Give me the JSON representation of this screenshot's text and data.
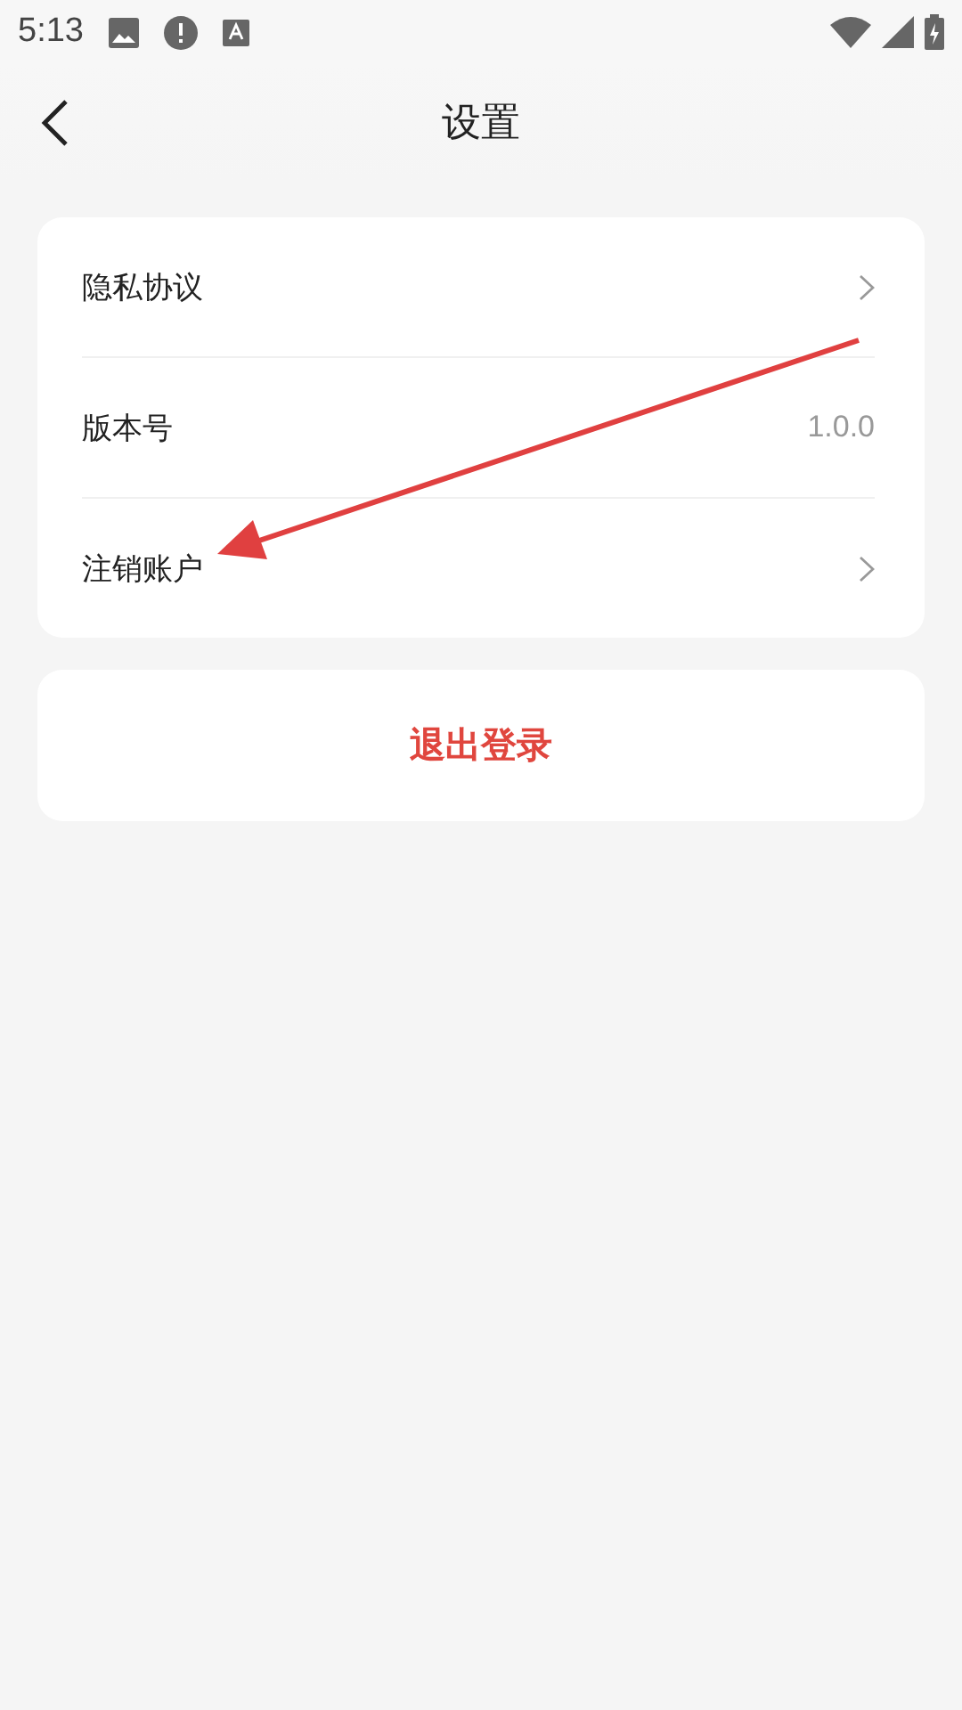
{
  "status_bar": {
    "time": "5:13"
  },
  "header": {
    "title": "设置"
  },
  "settings": [
    {
      "label": "隐私协议",
      "kind": "link"
    },
    {
      "label": "版本号",
      "kind": "value",
      "value": "1.0.0"
    },
    {
      "label": "注销账户",
      "kind": "link"
    }
  ],
  "logout_button": {
    "label": "退出登录"
  },
  "annotation": {
    "kind": "arrow"
  }
}
